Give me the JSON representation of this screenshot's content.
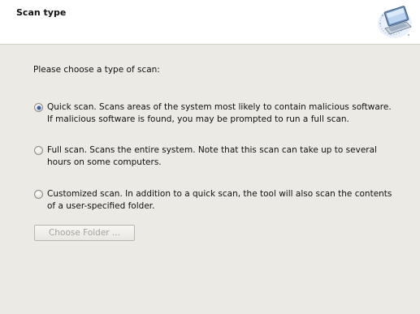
{
  "header": {
    "title": "Scan type",
    "icon": "computer-scan-icon"
  },
  "main": {
    "prompt": "Please choose a type of scan:",
    "options": [
      {
        "label": "Quick scan. Scans areas of the system most likely to contain malicious software. If malicious software is found, you may be prompted to run a full scan.",
        "selected": true
      },
      {
        "label": "Full scan. Scans the entire system. Note that this scan can take up to several hours on some computers.",
        "selected": false
      },
      {
        "label": "Customized scan. In addition to a quick scan, the tool will also scan the contents of a user-specified folder.",
        "selected": false
      }
    ],
    "choose_folder_label": "Choose Folder ...",
    "choose_folder_enabled": false
  },
  "colors": {
    "panel_background": "#eceae5",
    "header_background": "#ffffff",
    "radio_selected": "#3a5fb0",
    "disabled_text": "#a6a39d"
  }
}
